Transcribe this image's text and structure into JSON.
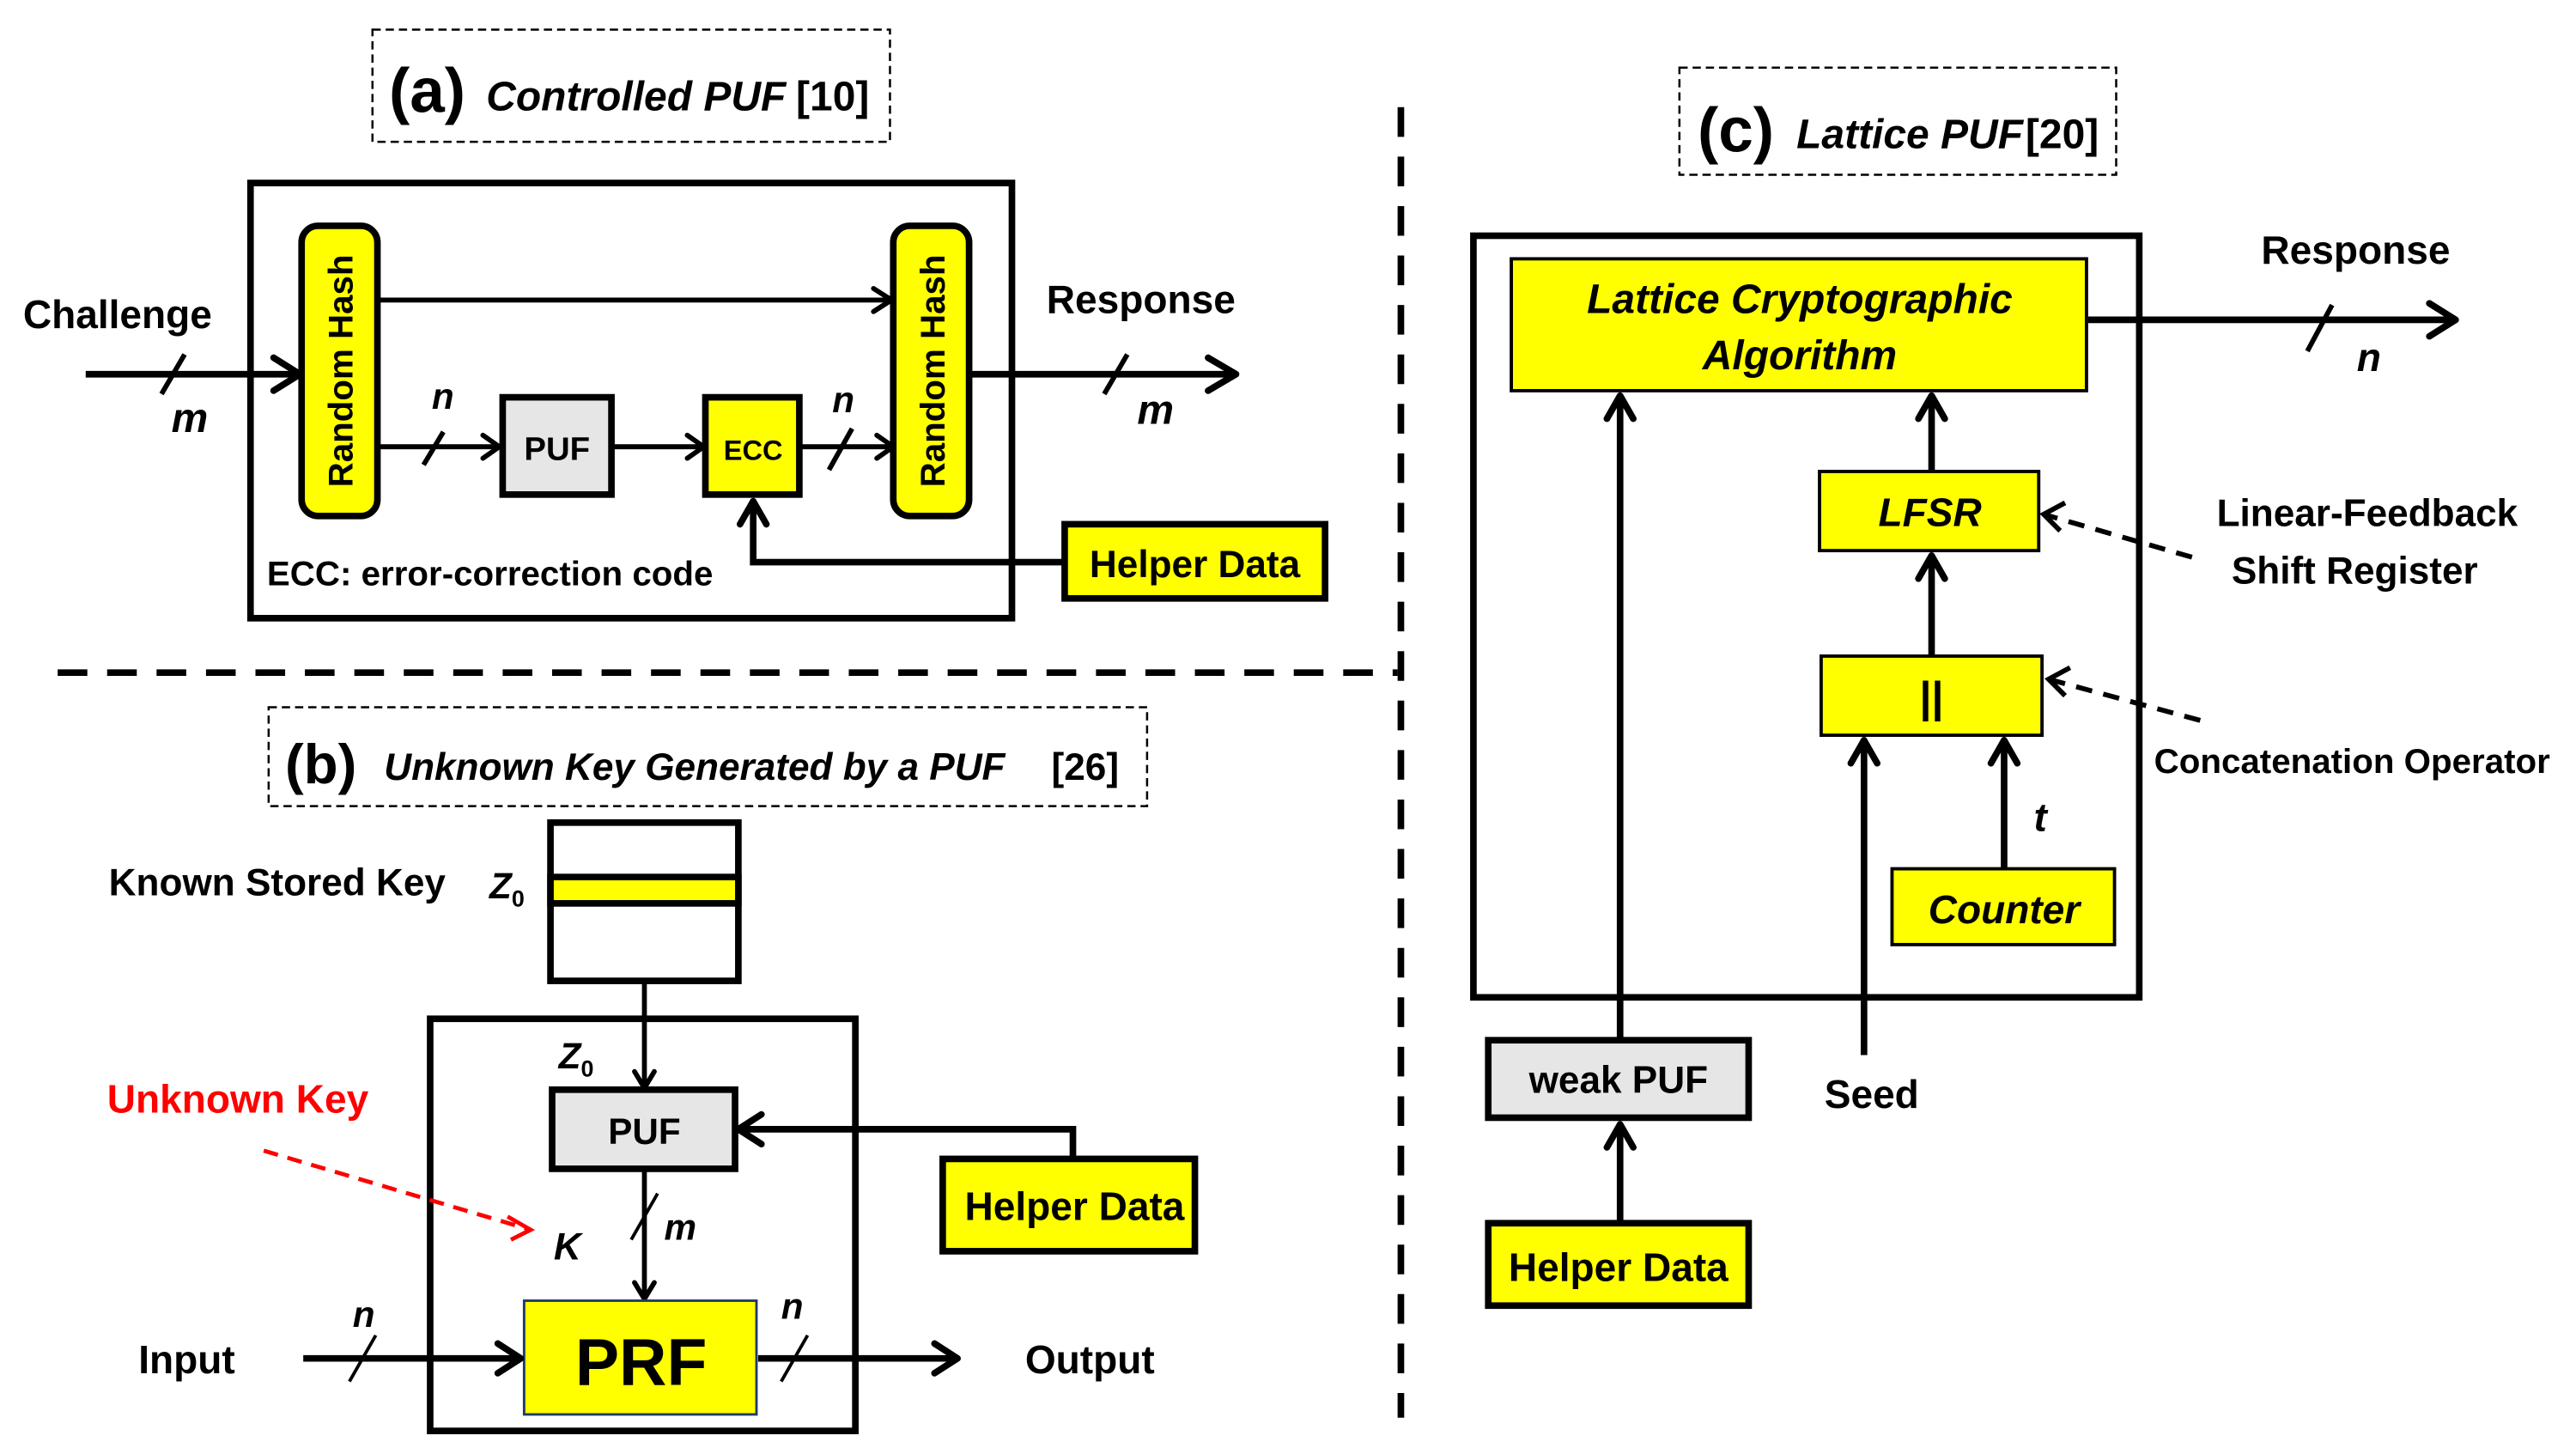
{
  "colors": {
    "yellow": "#ffff00",
    "gray": "#e6e6e6",
    "red": "#ff0000",
    "black": "#000000"
  },
  "panel_a": {
    "tag": "(a)",
    "title": "Controlled PUF",
    "ref": "[10]",
    "challenge": "Challenge",
    "response": "Response",
    "hash_left": "Random Hash",
    "hash_right": "Random Hash",
    "puf": "PUF",
    "ecc": "ECC",
    "helper": "Helper Data",
    "note": "ECC: error-correction code",
    "bus_in": "m",
    "bus_out": "m",
    "bus_puf": "n",
    "bus_ecc": "n"
  },
  "panel_b": {
    "tag": "(b)",
    "title": "Unknown Key Generated by a PUF",
    "ref": "[26]",
    "stored_key": "Known Stored Key",
    "z": "Z",
    "z_sub": "0",
    "unknown_key": "Unknown Key",
    "puf": "PUF",
    "helper": "Helper Data",
    "k": "K",
    "bus_k": "m",
    "prf": "PRF",
    "input": "Input",
    "output": "Output",
    "bus_in": "n",
    "bus_out": "n"
  },
  "panel_c": {
    "tag": "(c)",
    "title": "Lattice PUF",
    "ref": "[20]",
    "algo_line1": "Lattice Cryptographic",
    "algo_line2": "Algorithm",
    "response": "Response",
    "bus_out": "n",
    "lfsr": "LFSR",
    "lfsr_note_1": "Linear-Feedback",
    "lfsr_note_2": "Shift Register",
    "concat": "||",
    "concat_note": "Concatenation Operator",
    "t": "t",
    "counter": "Counter",
    "weak_puf": "weak PUF",
    "seed": "Seed",
    "helper": "Helper Data"
  }
}
